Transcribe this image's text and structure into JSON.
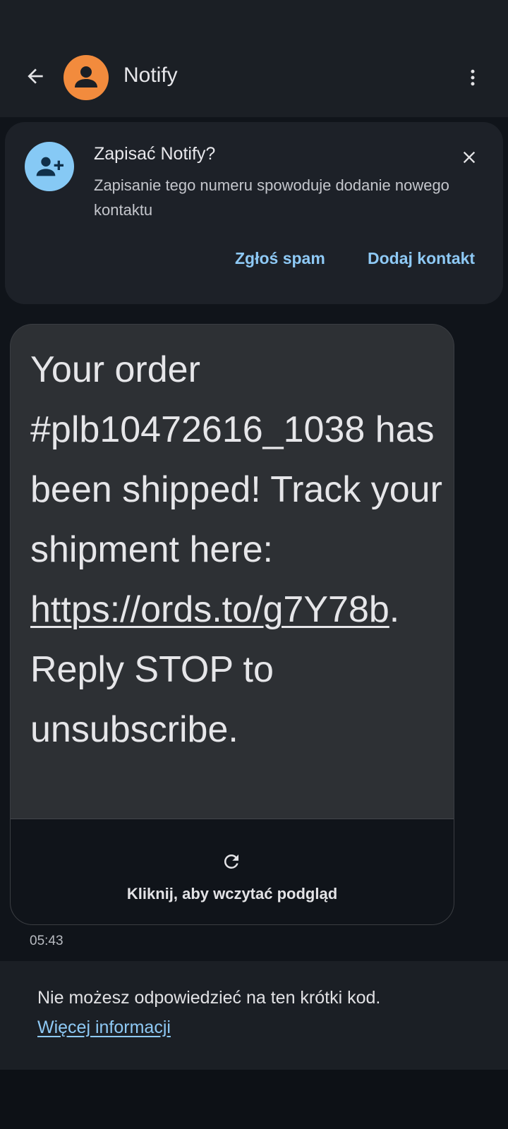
{
  "header": {
    "title": "Notify",
    "avatar_color": "#f28b3d",
    "back_icon": "arrow-left-icon",
    "more_icon": "more-vert-icon"
  },
  "save_card": {
    "title": "Zapisać Notify?",
    "description": "Zapisanie tego numeru spowoduje dodanie nowego kontaktu",
    "report_spam_label": "Zgłoś spam",
    "add_contact_label": "Dodaj kontakt",
    "icon": "person-add-icon",
    "icon_bg_color": "#86c9f5",
    "accent_color": "#8ec9f5"
  },
  "message": {
    "text_before_link": "Your order #plb10472616_1038 has been shipped! Track your shipment here: ",
    "link": "https://ords.to/g7Y78b",
    "text_after_link": ". Reply STOP to unsubscribe.",
    "preview_label": "Kliknij, aby wczytać podgląd",
    "time": "05:43"
  },
  "footer": {
    "notice": "Nie możesz odpowiedzieć na ten krótki kod.",
    "more_info_link": "Więcej informacji"
  }
}
